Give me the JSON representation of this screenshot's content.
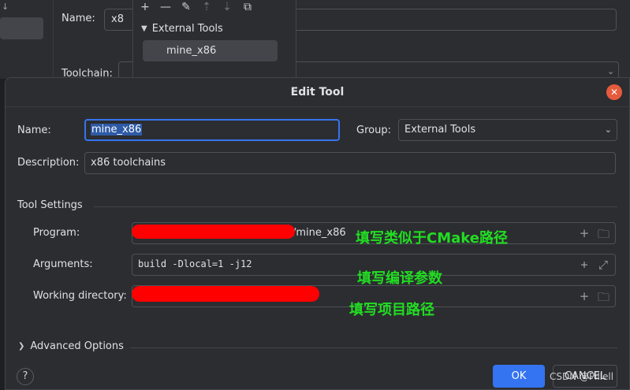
{
  "background": {
    "name_label": "Name:",
    "name_value": "x8",
    "toolchain_label": "Toolchain:",
    "tree": {
      "group_label": "External Tools",
      "item_label": "mine_x86"
    }
  },
  "dialog": {
    "title": "Edit Tool",
    "name_label": "Name:",
    "name_value": "mine_x86",
    "group_label": "Group:",
    "group_value": "External Tools",
    "description_label": "Description:",
    "description_value": "x86 toolchains",
    "tool_settings_label": "Tool Settings",
    "program_label": "Program:",
    "program_value": "/mine_x86",
    "arguments_label": "Arguments:",
    "arguments_value": "build -Dlocal=1 -j12",
    "working_dir_label": "Working directory:",
    "advanced_label": "Advanced Options",
    "help_label": "?",
    "ok_label": "OK",
    "cancel_label": "CANCEL"
  },
  "annotations": {
    "program_note": "填写类似于CMake路径",
    "arguments_note": "填写编译参数",
    "working_dir_note": "填写项目路径"
  },
  "watermark": "CSDN @Pillell",
  "colors": {
    "accent": "#3574f0",
    "close": "#e55b3c",
    "annotation": "#22dd22",
    "redaction": "#ff0000"
  }
}
